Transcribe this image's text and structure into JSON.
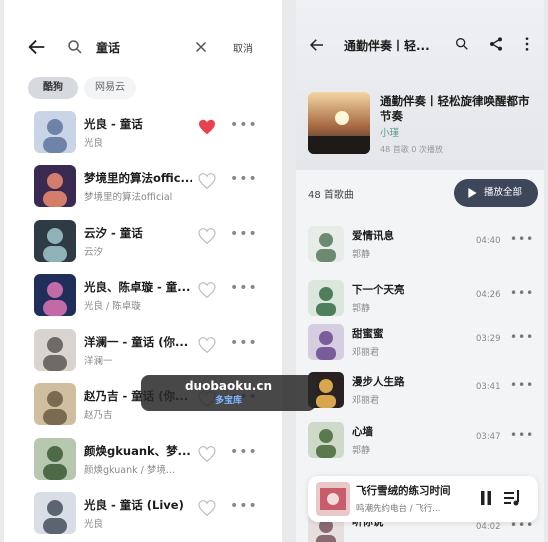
{
  "search": {
    "query": "童话",
    "cancel_label": "取消",
    "tabs": [
      "酷狗",
      "网易云"
    ]
  },
  "results": [
    {
      "title": "光良 - 童话",
      "subtitle": "光良",
      "liked": true
    },
    {
      "title": "梦境里的算法offic...",
      "subtitle": "梦境里的算法official",
      "liked": false
    },
    {
      "title": "云汐 - 童话",
      "subtitle": "云汐",
      "liked": false
    },
    {
      "title": "光良、陈卓璇 - 童...",
      "subtitle": "光良 / 陈卓璇",
      "liked": false
    },
    {
      "title": "洋澜一 - 童话 (你...",
      "subtitle": "洋澜一",
      "liked": false
    },
    {
      "title": "赵乃吉 - 童话 (你...",
      "subtitle": "赵乃吉",
      "liked": false
    },
    {
      "title": "颜焕gkuank、梦...",
      "subtitle": "颜焕gkuank / 梦境...",
      "liked": false
    },
    {
      "title": "光良 - 童话 (Live)",
      "subtitle": "光良",
      "liked": false
    }
  ],
  "playlist": {
    "header_title": "通勤伴奏丨轻...",
    "title": "通勤伴奏丨轻松旋律唤醒都市节奏",
    "owner": "小瑾",
    "stats": "48 首歌    0 次播放",
    "song_count": "48 首歌曲",
    "play_all_label": "播放全部"
  },
  "songs": [
    {
      "title": "爱情讯息",
      "artist": "郭静",
      "duration": "04:40"
    },
    {
      "title": "下一个天亮",
      "artist": "郭静",
      "duration": "04:26"
    },
    {
      "title": "甜蜜蜜",
      "artist": "邓丽君",
      "duration": "03:29"
    },
    {
      "title": "漫步人生路",
      "artist": "邓丽君",
      "duration": "03:41"
    },
    {
      "title": "心墙",
      "artist": "郭静",
      "duration": "03:47"
    },
    {
      "title": "听你说",
      "artist": "",
      "duration": "04:02"
    }
  ],
  "mini_player": {
    "title": "飞行雪绒的练习时间",
    "subtitle": "鸣潮先约电台 / 飞行..."
  },
  "watermark": {
    "line1": "duobaoku.cn",
    "line2": "多宝库"
  },
  "colors": {
    "accent": "#3e465a",
    "liked": "#e8424f"
  }
}
